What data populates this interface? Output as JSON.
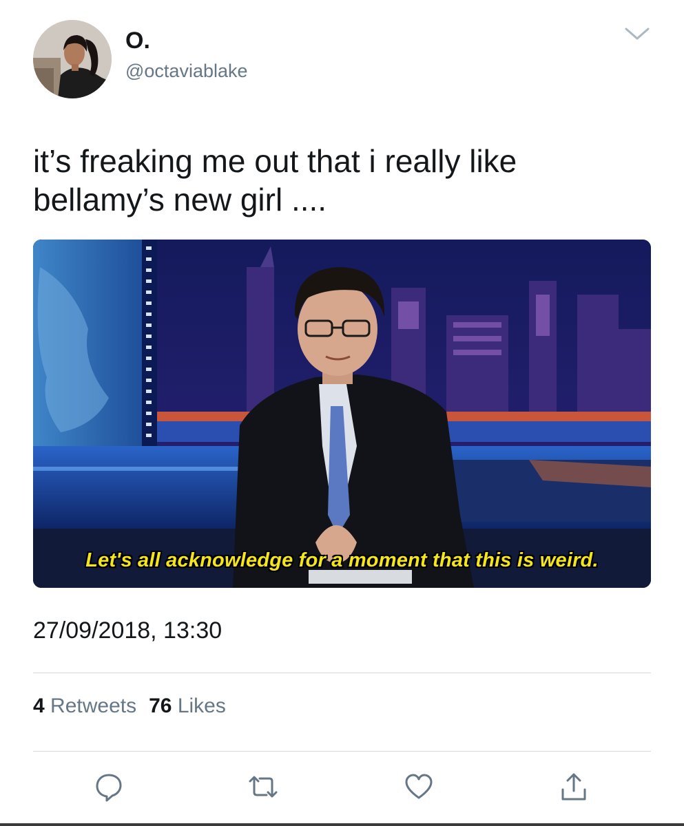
{
  "user": {
    "display_name": "O.",
    "handle": "@octaviablake",
    "avatar_icon": "profile-photo"
  },
  "tweet": {
    "text": "it’s freaking me out that i really like\nbellamy’s new girl ....",
    "media_caption": "Let's all acknowledge for a moment that this is weird.",
    "timestamp": "27/09/2018, 13:30"
  },
  "stats": {
    "retweets_count": "4",
    "retweets_label": "Retweets",
    "likes_count": "76",
    "likes_label": "Likes"
  },
  "actions": {
    "reply_icon": "reply-icon",
    "retweet_icon": "retweet-icon",
    "like_icon": "heart-icon",
    "share_icon": "share-icon"
  },
  "colors": {
    "primary_text": "#14171a",
    "secondary_text": "#657786",
    "divider": "#d4d9dd",
    "caption_yellow": "#f5e51b"
  }
}
